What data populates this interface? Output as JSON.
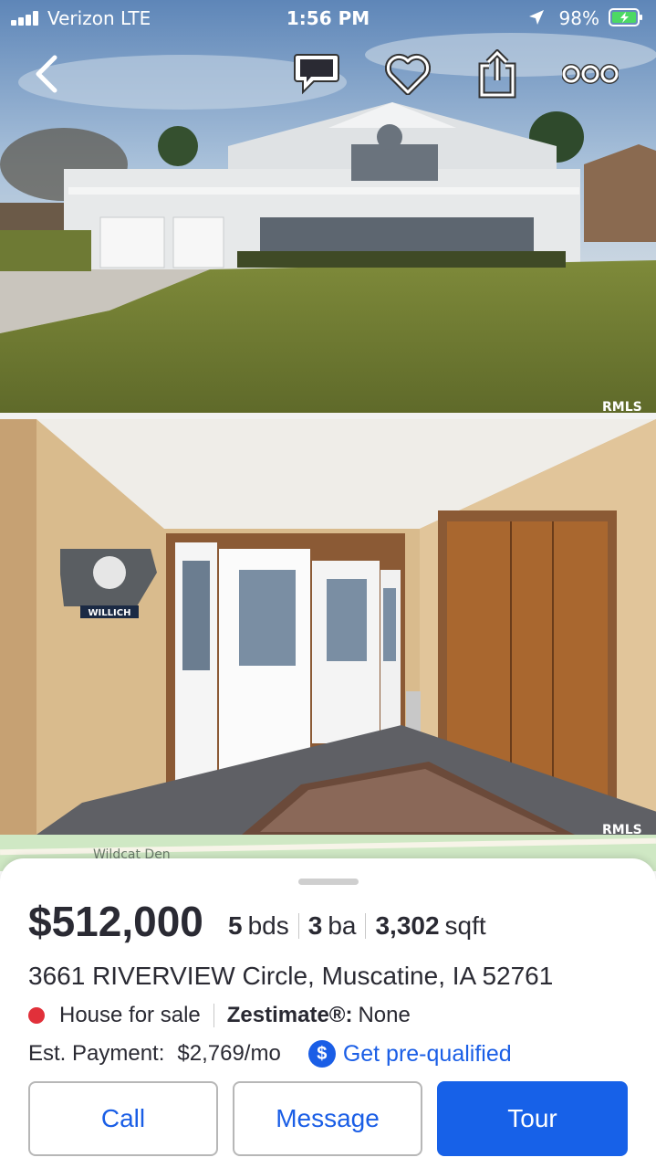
{
  "status_bar": {
    "carrier": "Verizon  LTE",
    "time": "1:56 PM",
    "battery": "98%"
  },
  "top_actions": {
    "back": "back-icon",
    "chat": "chat-icon",
    "favorite": "heart-icon",
    "share": "share-icon",
    "more": "more-icon"
  },
  "photos": [
    {
      "name": "exterior-photo",
      "watermark": "RMLS"
    },
    {
      "name": "entryway-photo",
      "sign_text": "WILLICH",
      "watermark": "RMLS"
    }
  ],
  "map": {
    "label": "Wildcat Den"
  },
  "listing": {
    "price": "$512,000",
    "beds": "5",
    "beds_unit": "bds",
    "baths": "3",
    "baths_unit": "ba",
    "sqft": "3,302",
    "sqft_unit": "sqft",
    "address": "3661 RIVERVIEW Circle, Muscatine, IA 52761",
    "status": "House for sale",
    "zestimate_label": "Zestimate®:",
    "zestimate_value": "None",
    "payment_label": "Est. Payment:",
    "payment_value": "$2,769/mo",
    "prequal_badge": "$",
    "prequal_link": "Get pre-qualified"
  },
  "actions": {
    "call": "Call",
    "message": "Message",
    "tour": "Tour"
  },
  "colors": {
    "accent": "#1a5ee6",
    "status_dot": "#e1303a"
  }
}
